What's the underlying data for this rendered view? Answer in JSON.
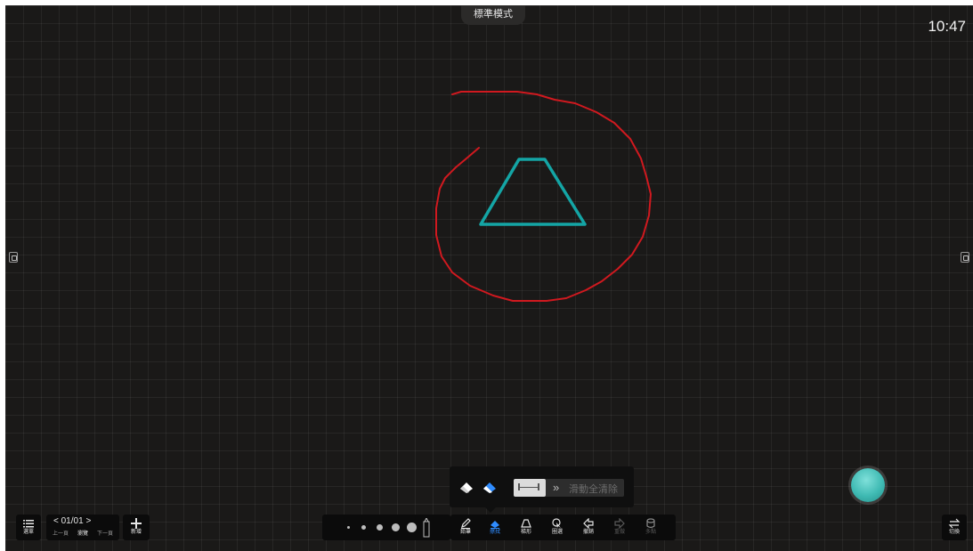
{
  "header": {
    "mode_tab": "標準模式",
    "clock": "10:47"
  },
  "toolbar_left": {
    "menu_label": "選單",
    "page_indicator": "01/01",
    "prev_label": "上一頁",
    "browse_label": "瀏覽",
    "next_label": "下一頁",
    "add_label": "新增"
  },
  "toolbar_center": {
    "pen_sizes": [
      "dot-1",
      "dot-2",
      "dot-3",
      "dot-4",
      "dot-5"
    ],
    "tools": [
      {
        "label": "鉛筆",
        "icon": "pencil-icon",
        "active": false,
        "enabled": true
      },
      {
        "label": "擦拭",
        "icon": "eraser-icon",
        "active": true,
        "enabled": true
      },
      {
        "label": "梯形",
        "icon": "trapezoid-icon",
        "active": false,
        "enabled": true
      },
      {
        "label": "圈選",
        "icon": "lasso-icon",
        "active": false,
        "enabled": true
      },
      {
        "label": "撤銷",
        "icon": "undo-icon",
        "active": false,
        "enabled": true
      },
      {
        "label": "重做",
        "icon": "redo-icon",
        "active": false,
        "enabled": false
      },
      {
        "label": "多點",
        "icon": "multi-touch-icon",
        "active": false,
        "enabled": false
      }
    ]
  },
  "eraser_popup": {
    "slide_clear_label": "滑動全清除",
    "arrows": "»"
  },
  "toolbar_right": {
    "switch_label": "切換"
  },
  "colors": {
    "board": "#1a1918",
    "stroke_red": "#d0191f",
    "stroke_teal": "#14a5a5",
    "accent_blue": "#2f8cff",
    "float_ball": "#3fbab3"
  }
}
